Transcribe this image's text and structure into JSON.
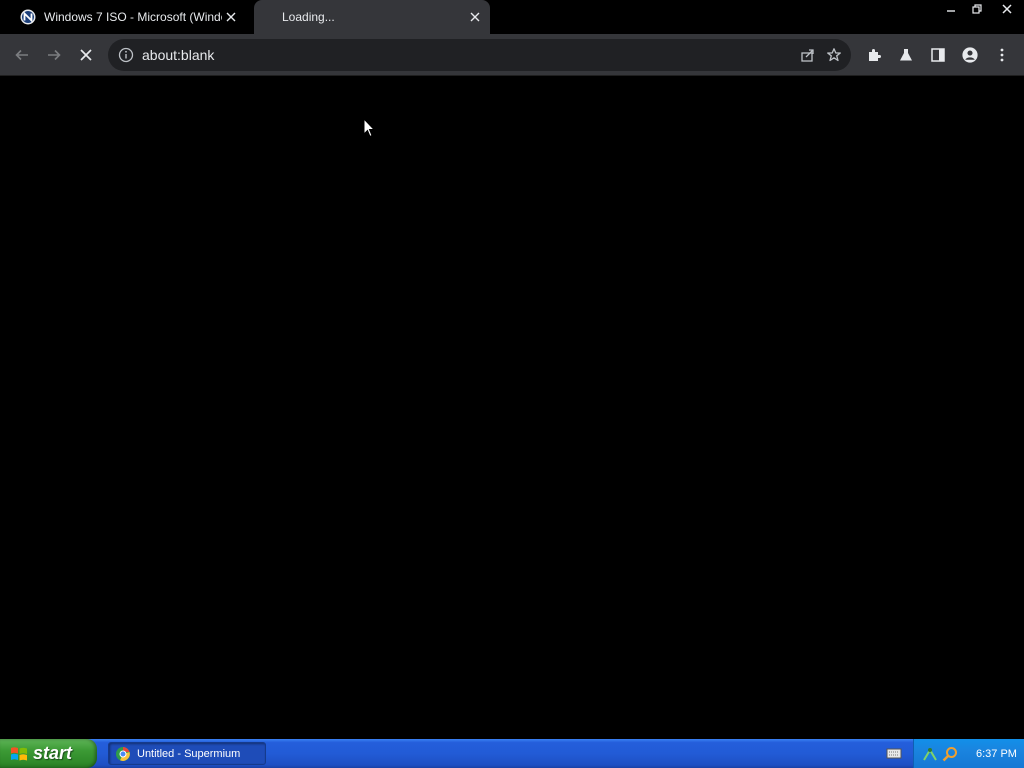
{
  "browser": {
    "tabs": [
      {
        "title": "Windows 7 ISO - Microsoft (Window",
        "favicon": "neowin-icon",
        "active": false
      },
      {
        "title": "Loading...",
        "favicon": "loading-spinner-icon",
        "active": true
      }
    ],
    "window_controls": [
      "minimize-icon",
      "restore-icon",
      "close-icon"
    ],
    "address": "about:blank",
    "toolbar_icons": [
      "back-arrow-icon",
      "forward-arrow-icon",
      "stop-loading-icon",
      "info-icon",
      "share-icon",
      "star-icon",
      "extensions-puzzle-icon",
      "labs-flask-icon",
      "side-panel-icon",
      "profile-avatar-icon",
      "kebab-menu-icon"
    ]
  },
  "taskbar": {
    "start_label": "start",
    "task_buttons": [
      {
        "label": "Untitled - Supermium",
        "icon": "supermium-browser-icon"
      }
    ],
    "clock": "6:37 PM",
    "tray_icons": [
      "keyboard-icon",
      "network-icon",
      "search-magnifier-icon"
    ]
  },
  "colors": {
    "tab_active": "#35363a",
    "toolbar": "#35363a",
    "omnibox": "#202124",
    "text": "#e8eaed",
    "xp_taskbar": "#245edb",
    "xp_start": "#3c9a35",
    "xp_tray": "#1a84df"
  }
}
